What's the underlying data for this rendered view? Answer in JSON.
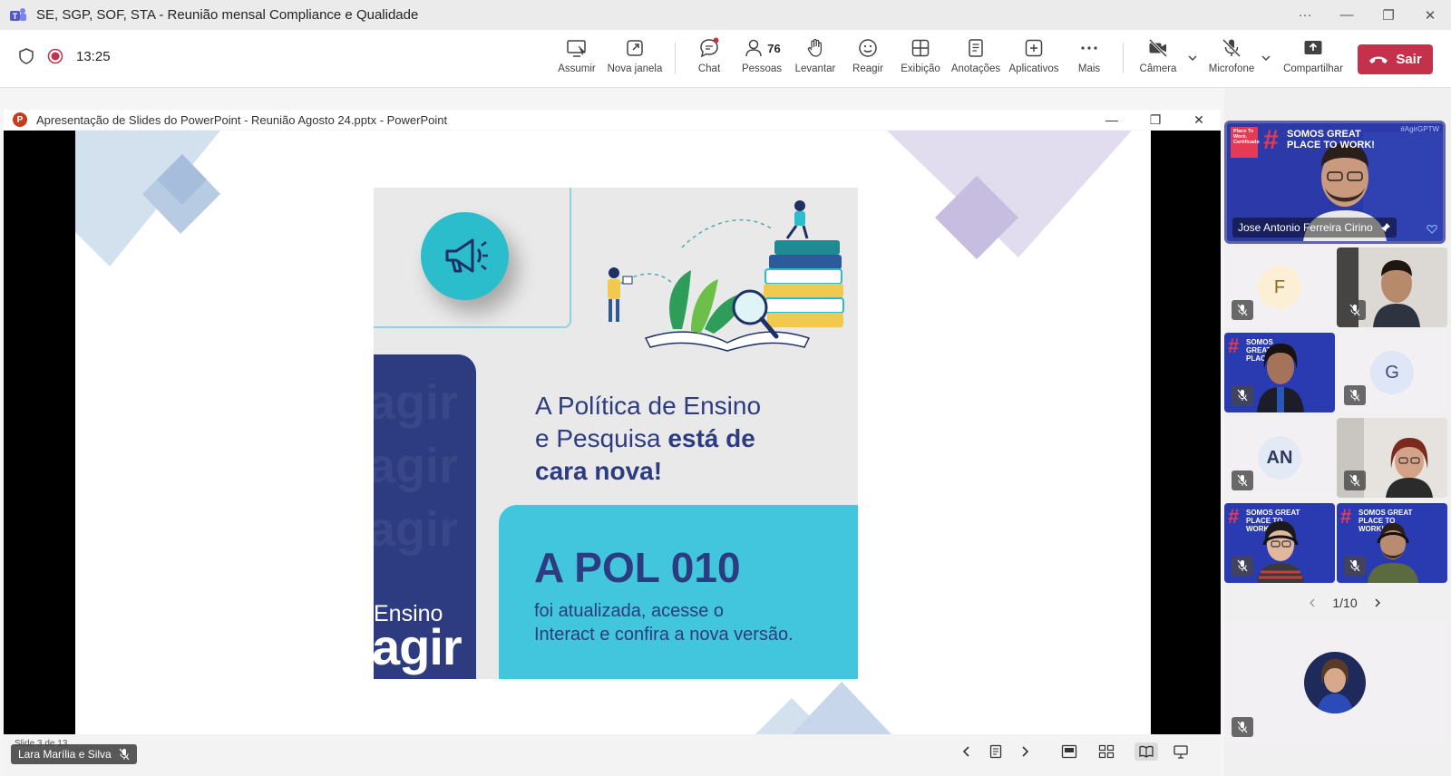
{
  "window": {
    "title": "SE, SGP, SOF, STA - Reunião mensal Compliance e Qualidade",
    "controls": {
      "more": "···",
      "minimize": "—",
      "restore": "❐",
      "close": "✕"
    }
  },
  "meeting": {
    "elapsed_time": "13:25",
    "toolbar": {
      "assumir": "Assumir",
      "nova_janela": "Nova janela",
      "chat": "Chat",
      "pessoas": "Pessoas",
      "pessoas_count": "76",
      "levantar": "Levantar",
      "reagir": "Reagir",
      "exibicao": "Exibição",
      "anotacoes": "Anotações",
      "aplicativos": "Aplicativos",
      "mais": "Mais",
      "camera": "Câmera",
      "microfone": "Microfone",
      "compartilhar": "Compartilhar",
      "sair": "Sair"
    }
  },
  "shared_window": {
    "title": "Apresentação de Slides do PowerPoint  -  Reunião Agosto 24.pptx - PowerPoint",
    "app_icon_letter": "P",
    "controls": {
      "minimize": "—",
      "restore": "❐",
      "close": "✕"
    },
    "slide": {
      "headline_line1": "A Política de Ensino",
      "headline_line2_regular": "e Pesquisa ",
      "headline_line2_bold": "está de",
      "headline_line3_bold": "cara nova!",
      "pol_title": "A POL 010",
      "pol_body_line1": "foi atualizada, acesse o",
      "pol_body_line2": "Interact e confira a nova versão.",
      "logo_small": "Ensino",
      "logo_large": "agir",
      "watermark": "agir"
    },
    "status": {
      "slide_counter": "Slide 3 de 13",
      "presenter_name": "Lara Marília e Silva"
    }
  },
  "participants": {
    "featured_name": "Jose Antonio Ferreira Cirino",
    "featured_banner": "SOMOS GREAT PLACE TO WORK!",
    "featured_badge": "Place To Work. Certificado",
    "featured_tag": "#AgirGPTW",
    "tiles": [
      {
        "kind": "initials",
        "initials": "F"
      },
      {
        "kind": "video"
      },
      {
        "kind": "video",
        "banner": "SOMOS GREAT PLAC"
      },
      {
        "kind": "initials",
        "initials": "G"
      },
      {
        "kind": "initials",
        "initials": "AN"
      },
      {
        "kind": "video"
      },
      {
        "kind": "video",
        "banner": "SOMOS GREAT PLACE TO WORK!"
      },
      {
        "kind": "video",
        "banner": "SOMOS GREAT PLACE TO WORK!"
      }
    ],
    "pager": "1/10"
  },
  "colors": {
    "leave": "#c4314b",
    "teams_purple": "#6264a7",
    "slide_navy": "#2d3b80",
    "slide_cyan": "#42c6dd"
  }
}
